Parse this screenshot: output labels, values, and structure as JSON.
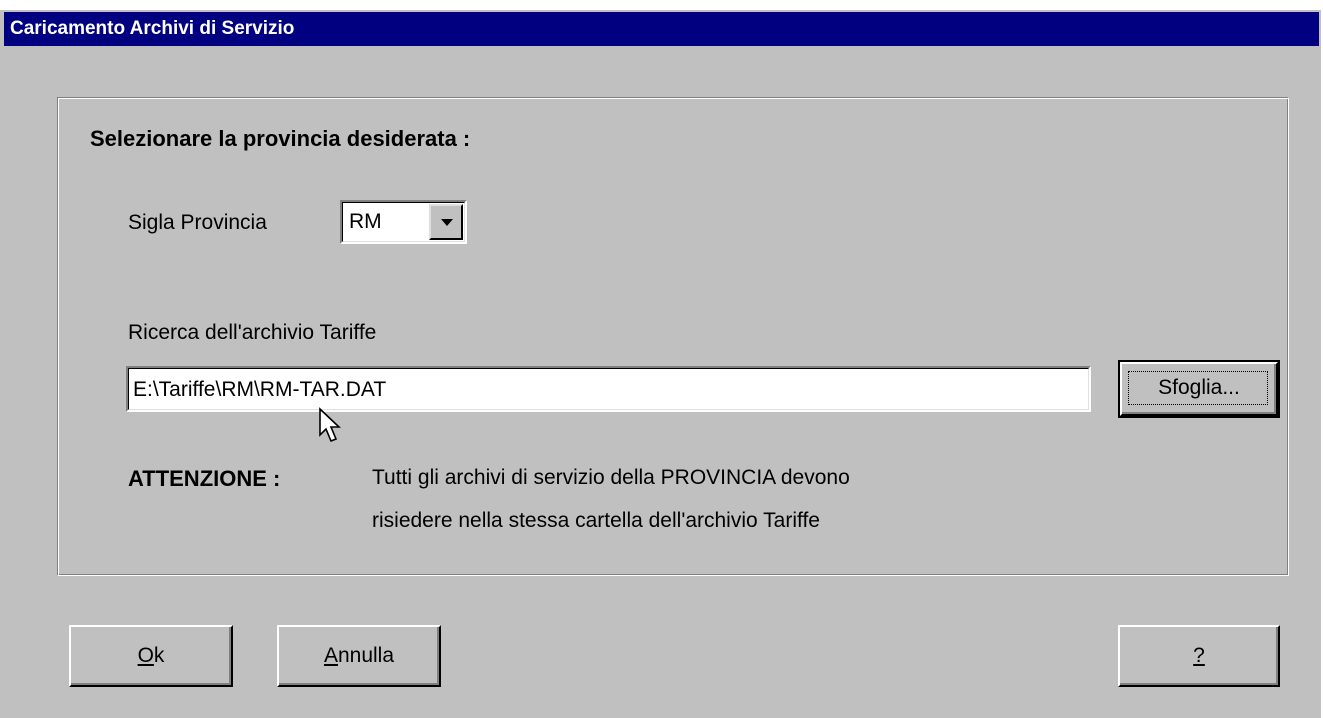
{
  "window": {
    "title": "Caricamento Archivi di Servizio"
  },
  "group": {
    "heading": "Selezionare la provincia desiderata :"
  },
  "province": {
    "label": "Sigla Provincia",
    "selected": "RM"
  },
  "archive": {
    "label": "Ricerca dell'archivio Tariffe",
    "path": "E:\\Tariffe\\RM\\RM-TAR.DAT",
    "browse_button": "Sfoglia..."
  },
  "warning": {
    "label": "ATTENZIONE :",
    "line1": "Tutti gli archivi di servizio della PROVINCIA devono",
    "line2": "risiedere nella stessa cartella dell'archivio Tariffe"
  },
  "buttons": {
    "ok": {
      "mnemonic": "O",
      "rest": "k"
    },
    "cancel": {
      "mnemonic": "A",
      "rest": "nnulla"
    },
    "help": {
      "mnemonic": "?",
      "rest": ""
    }
  },
  "icons": {
    "dropdown": "chevron-down-icon",
    "cursor": "mouse-pointer-icon"
  }
}
